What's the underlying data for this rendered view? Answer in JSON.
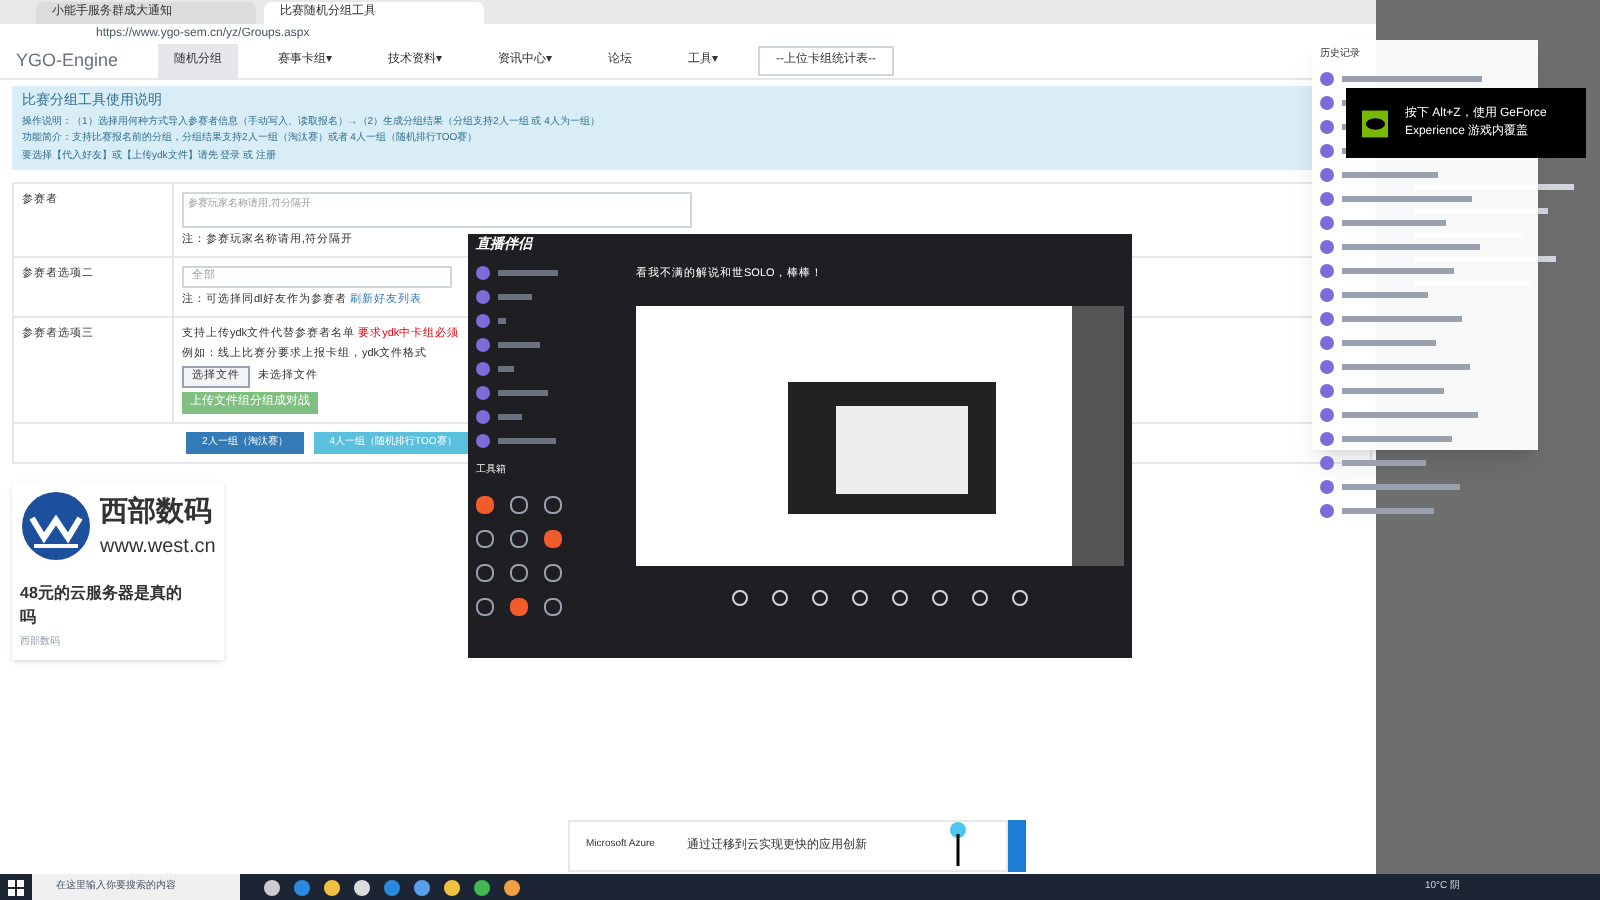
{
  "browser": {
    "tabs": [
      {
        "label": "小能手服务群成大通知",
        "selected": false
      },
      {
        "label": "比赛随机分组工具",
        "selected": true
      }
    ],
    "url": "https://www.ygo-sem.cn/yz/Groups.aspx"
  },
  "nav": {
    "brand": "YGO-Engine",
    "items": [
      {
        "label": "随机分组",
        "selected": true
      },
      {
        "label": "赛事卡组▾",
        "selected": false
      },
      {
        "label": "技术资料▾",
        "selected": false
      },
      {
        "label": "资讯中心▾",
        "selected": false
      },
      {
        "label": "论坛",
        "selected": false
      },
      {
        "label": "工具▾",
        "selected": false
      }
    ],
    "select": "--上位卡组统计表--"
  },
  "info": {
    "title": "比赛分组工具使用说明",
    "lines": [
      "操作说明：（1）选择用何种方式导入参赛者信息（手动写入、读取报名）→（2）生成分组结果（分组支持2人一组 或 4人为一组）",
      "功能简介：支持比赛报名前的分组，分组结果支持2人一组（淘汰赛）或者 4人一组（随机排行TOO赛）",
      "要选择【代入好友】或【上传ydk文件】请先 登录 或 注册"
    ]
  },
  "form": {
    "rows": [
      {
        "label": "参赛者",
        "kind": "textarea",
        "placeholder": "参赛玩家名称请用,符分隔开",
        "note": "注：参赛玩家名称请用,符分隔开"
      },
      {
        "label": "参赛者选项二",
        "kind": "select",
        "value": "全部",
        "note": "注：可选择同dl好友作为参赛者",
        "link": "刷新好友列表"
      },
      {
        "label": "参赛者选项三",
        "kind": "upload",
        "text": "支持上传ydk文件代替参赛者名单",
        "warn": "要求ydk中卡组必须",
        "hint": "例如：线上比赛分要求上报卡组，ydk文件格式",
        "file_button": "选择文件",
        "file_status": "未选择文件",
        "upload_button": "上传文件组分组成对战"
      }
    ],
    "buttons": [
      {
        "label": "2人一组（淘汰赛）",
        "kind": "primary"
      },
      {
        "label": "4人一组（随机排行TOO赛）",
        "kind": "info"
      }
    ]
  },
  "ad": {
    "brand": "西部数码",
    "site": "www.west.cn",
    "headline": "48元的云服务器是真的吗",
    "source": "西部数码"
  },
  "stream_app": {
    "title": "直播伴侣",
    "toolbox": "工具箱",
    "stream_title": "看我不满的解说和世SOLO，棒棒！"
  },
  "history": {
    "title": "历史记录"
  },
  "toast": {
    "text": "按下 Alt+Z，使用 GeForce Experience 游戏内覆盖"
  },
  "bottom_ad": {
    "brand": "Microsoft Azure",
    "text": "通过迁移到云实现更快的应用创新"
  },
  "taskbar": {
    "search": "在这里输入你要搜索的内容",
    "weather": "10°C 阴"
  }
}
